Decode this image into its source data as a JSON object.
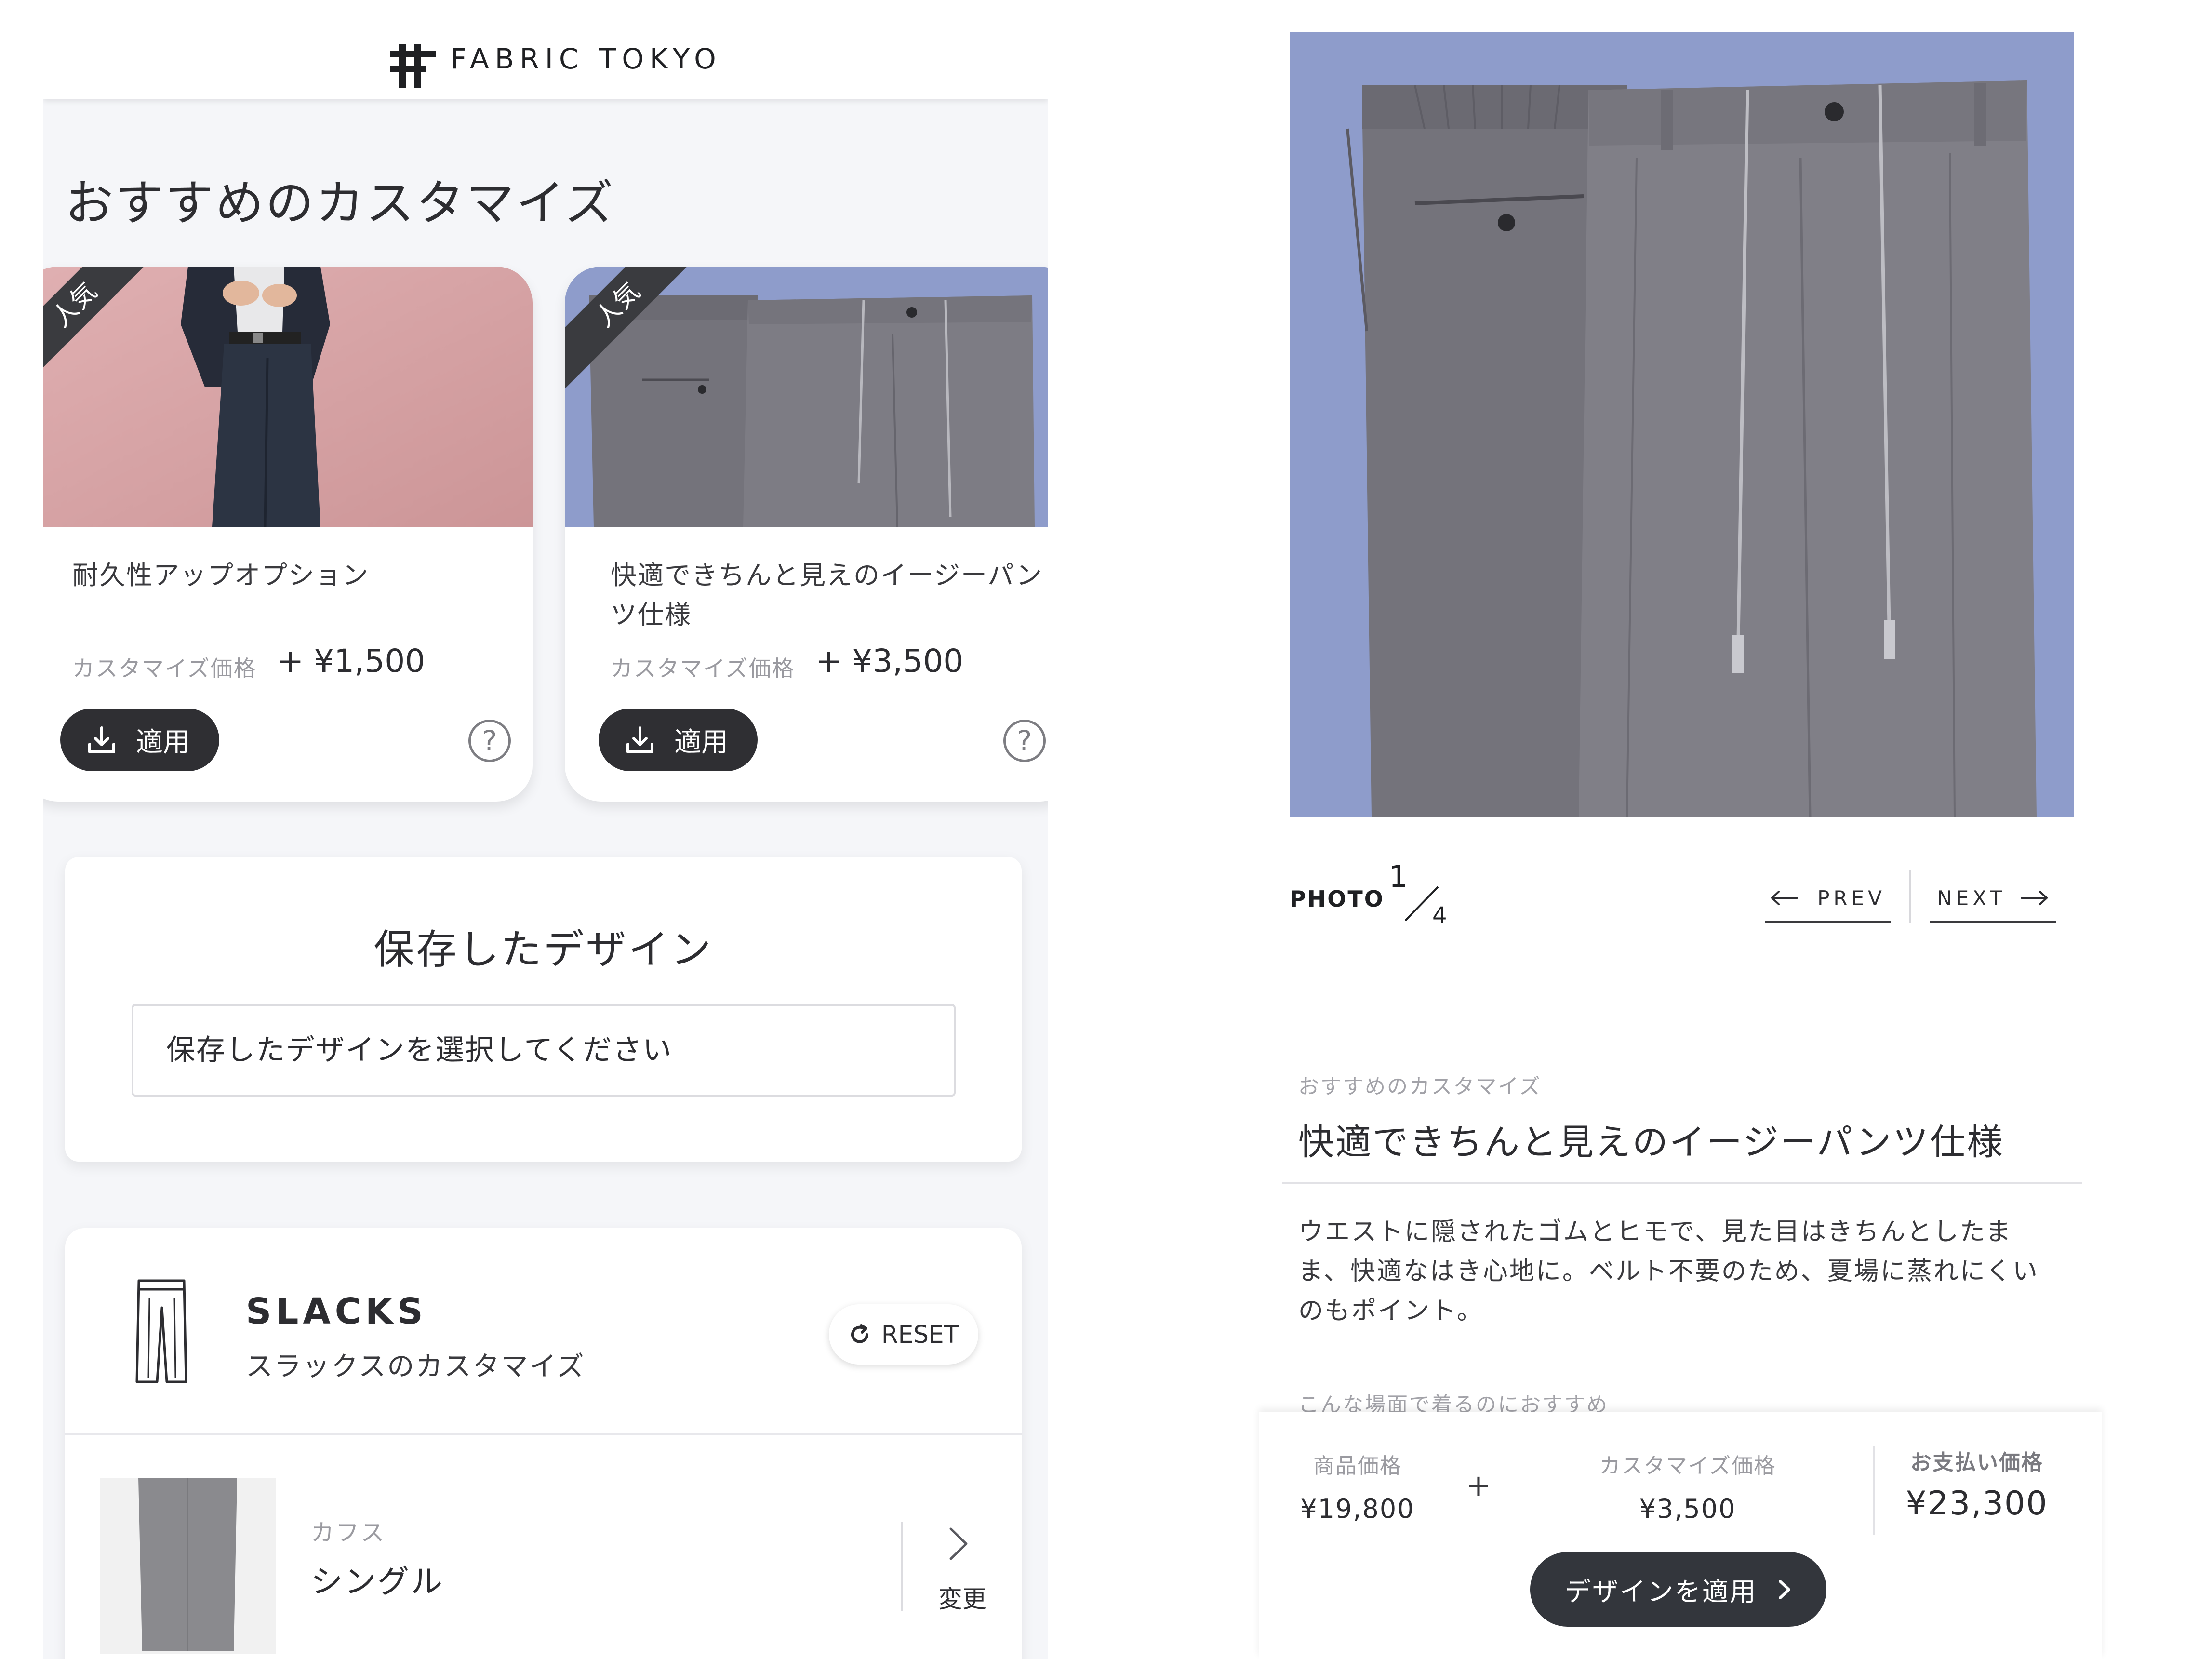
{
  "left": {
    "header": {
      "brand": "FABRIC TOKYO"
    },
    "recommend": {
      "title": "おすすめのカスタマイズ",
      "cards": [
        {
          "badge": "人気",
          "name": "耐久性アップオプション",
          "price_label": "カスタマイズ価格",
          "price": "+ ¥1,500",
          "apply_label": "適用",
          "help": "?"
        },
        {
          "badge": "人気",
          "name": "快適できちんと見えのイージーパンツ仕様",
          "price_label": "カスタマイズ価格",
          "price": "+ ¥3,500",
          "apply_label": "適用",
          "help": "?"
        }
      ]
    },
    "saved_design": {
      "title": "保存したデザイン",
      "select_value": "保存したデザインを選択してください"
    },
    "slacks": {
      "title": "SLACKS",
      "subtitle": "スラックスのカスタマイズ",
      "reset_label": "RESET",
      "option": {
        "label": "カフス",
        "value": "シングル",
        "change_label": "変更"
      }
    }
  },
  "right": {
    "photo": {
      "label": "PHOTO",
      "current": "1",
      "total": "4",
      "prev_label": "PREV",
      "next_label": "NEXT"
    },
    "detail": {
      "category": "おすすめのカスタマイズ",
      "title": "快適できちんと見えのイージーパンツ仕様",
      "description": "ウエストに隠されたゴムとヒモで、見た目はきちんとしたまま、快適なはき心地に。ベルト不要のため、夏場に蒸れにくいのもポイント。",
      "scene_label": "こんな場面で着るのにおすすめ"
    },
    "price_bar": {
      "product_label": "商品価格",
      "product_value": "¥19,800",
      "plus": "+",
      "custom_label": "カスタマイズ価格",
      "custom_value": "¥3,500",
      "pay_label": "お支払い価格",
      "pay_value": "¥23,300",
      "apply_button": "デザインを適用"
    }
  },
  "colors": {
    "dark_button": "#2f2f33",
    "photo_bg": "#8e9ccb",
    "pink_bg": "#d9a3a6",
    "page_bg": "#f5f6f9"
  }
}
